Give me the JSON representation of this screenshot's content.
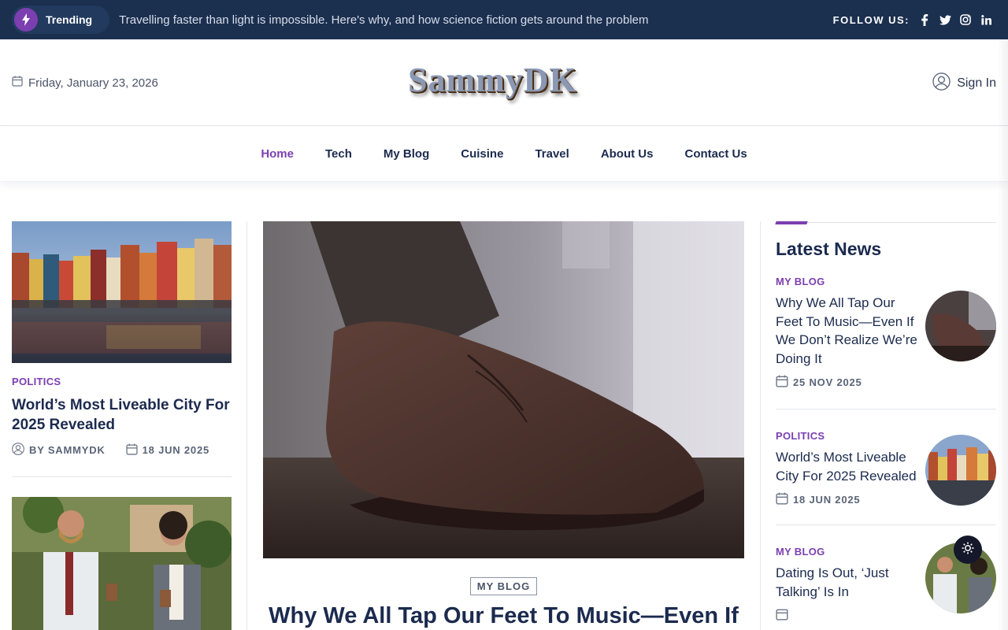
{
  "topbar": {
    "trending_label": "Trending",
    "ticker": "Travelling faster than light is impossible. Here's why, and how science fiction gets around the problem",
    "follow_label": "FOLLOW US:",
    "social": [
      "facebook-icon",
      "twitter-icon",
      "instagram-icon",
      "linkedin-icon"
    ]
  },
  "header": {
    "date": "Friday, January 23, 2026",
    "logo": "SammyDK",
    "signin": "Sign In"
  },
  "nav": {
    "items": [
      "Home",
      "Tech",
      "My Blog",
      "Cuisine",
      "Travel",
      "About Us",
      "Contact Us"
    ],
    "active": "Home"
  },
  "left": {
    "post": {
      "category": "POLITICS",
      "title": "World’s Most Liveable City For 2025 Revealed",
      "author": "BY SAMMYDK",
      "date": "18 JUN 2025"
    }
  },
  "featured": {
    "category": "MY BLOG",
    "title": "Why We All Tap Our Feet To Music—Even If"
  },
  "latest": {
    "title": "Latest News",
    "items": [
      {
        "category": "MY BLOG",
        "title": "Why We All Tap Our Feet To Music—Even If We Don’t Realize We’re Doing It",
        "date": "25 NOV 2025"
      },
      {
        "category": "POLITICS",
        "title": "World’s Most Liveable City For 2025 Revealed",
        "date": "18 JUN 2025"
      },
      {
        "category": "MY BLOG",
        "title": "Dating Is Out, ‘Just Talking’ Is In",
        "date": ""
      }
    ]
  },
  "colors": {
    "navy": "#1b2f4f",
    "accent": "#7b3fb0",
    "text": "#1b2a4e"
  }
}
